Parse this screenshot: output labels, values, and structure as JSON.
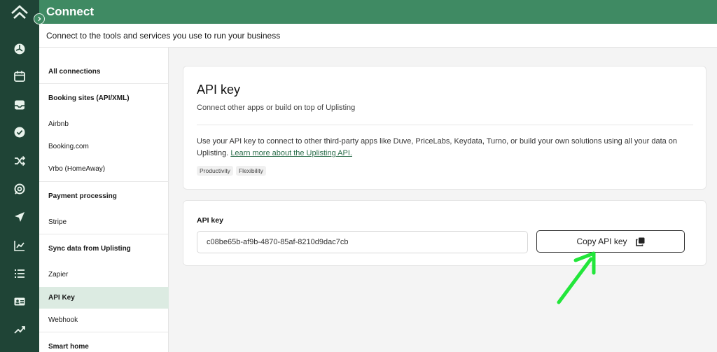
{
  "app": {
    "title": "Connect",
    "subtitle": "Connect to the tools and services you use to run your business"
  },
  "rail": {
    "icons": [
      "logo-icon",
      "dashboard-icon",
      "calendar-icon",
      "inbox-icon",
      "check-icon",
      "shuffle-icon",
      "support-icon",
      "send-icon",
      "analytics-icon",
      "list-icon",
      "id-card-icon",
      "trending-icon"
    ]
  },
  "sidebar": {
    "all_connections": "All connections",
    "sections": [
      {
        "header": "Booking sites (API/XML)",
        "items": [
          "Airbnb",
          "Booking.com",
          "Vrbo (HomeAway)"
        ]
      },
      {
        "header": "Payment processing",
        "items": [
          "Stripe"
        ]
      },
      {
        "header": "Sync data from Uplisting",
        "items": [
          "Zapier",
          "API Key",
          "Webhook"
        ]
      },
      {
        "header": "Smart home",
        "items": []
      }
    ],
    "active_item": "API Key"
  },
  "card": {
    "title": "API key",
    "subtitle": "Connect other apps or build on top of Uplisting",
    "description": "Use your API key to connect to other third-party apps like Duve, PriceLabs, Keydata, Turno, or build your own solutions using all your data on Uplisting.",
    "link_text": "Learn more about the Uplisting API.",
    "tags": [
      "Productivity",
      "Flexibility"
    ]
  },
  "api_key": {
    "label": "API key",
    "value": "c08be65b-af9b-4870-85af-8210d9dac7cb",
    "copy_label": "Copy API key"
  },
  "colors": {
    "rail": "#1f4436",
    "topbar": "#3f8a63",
    "active_nav": "#dcebe2",
    "arrow": "#22e63a"
  }
}
